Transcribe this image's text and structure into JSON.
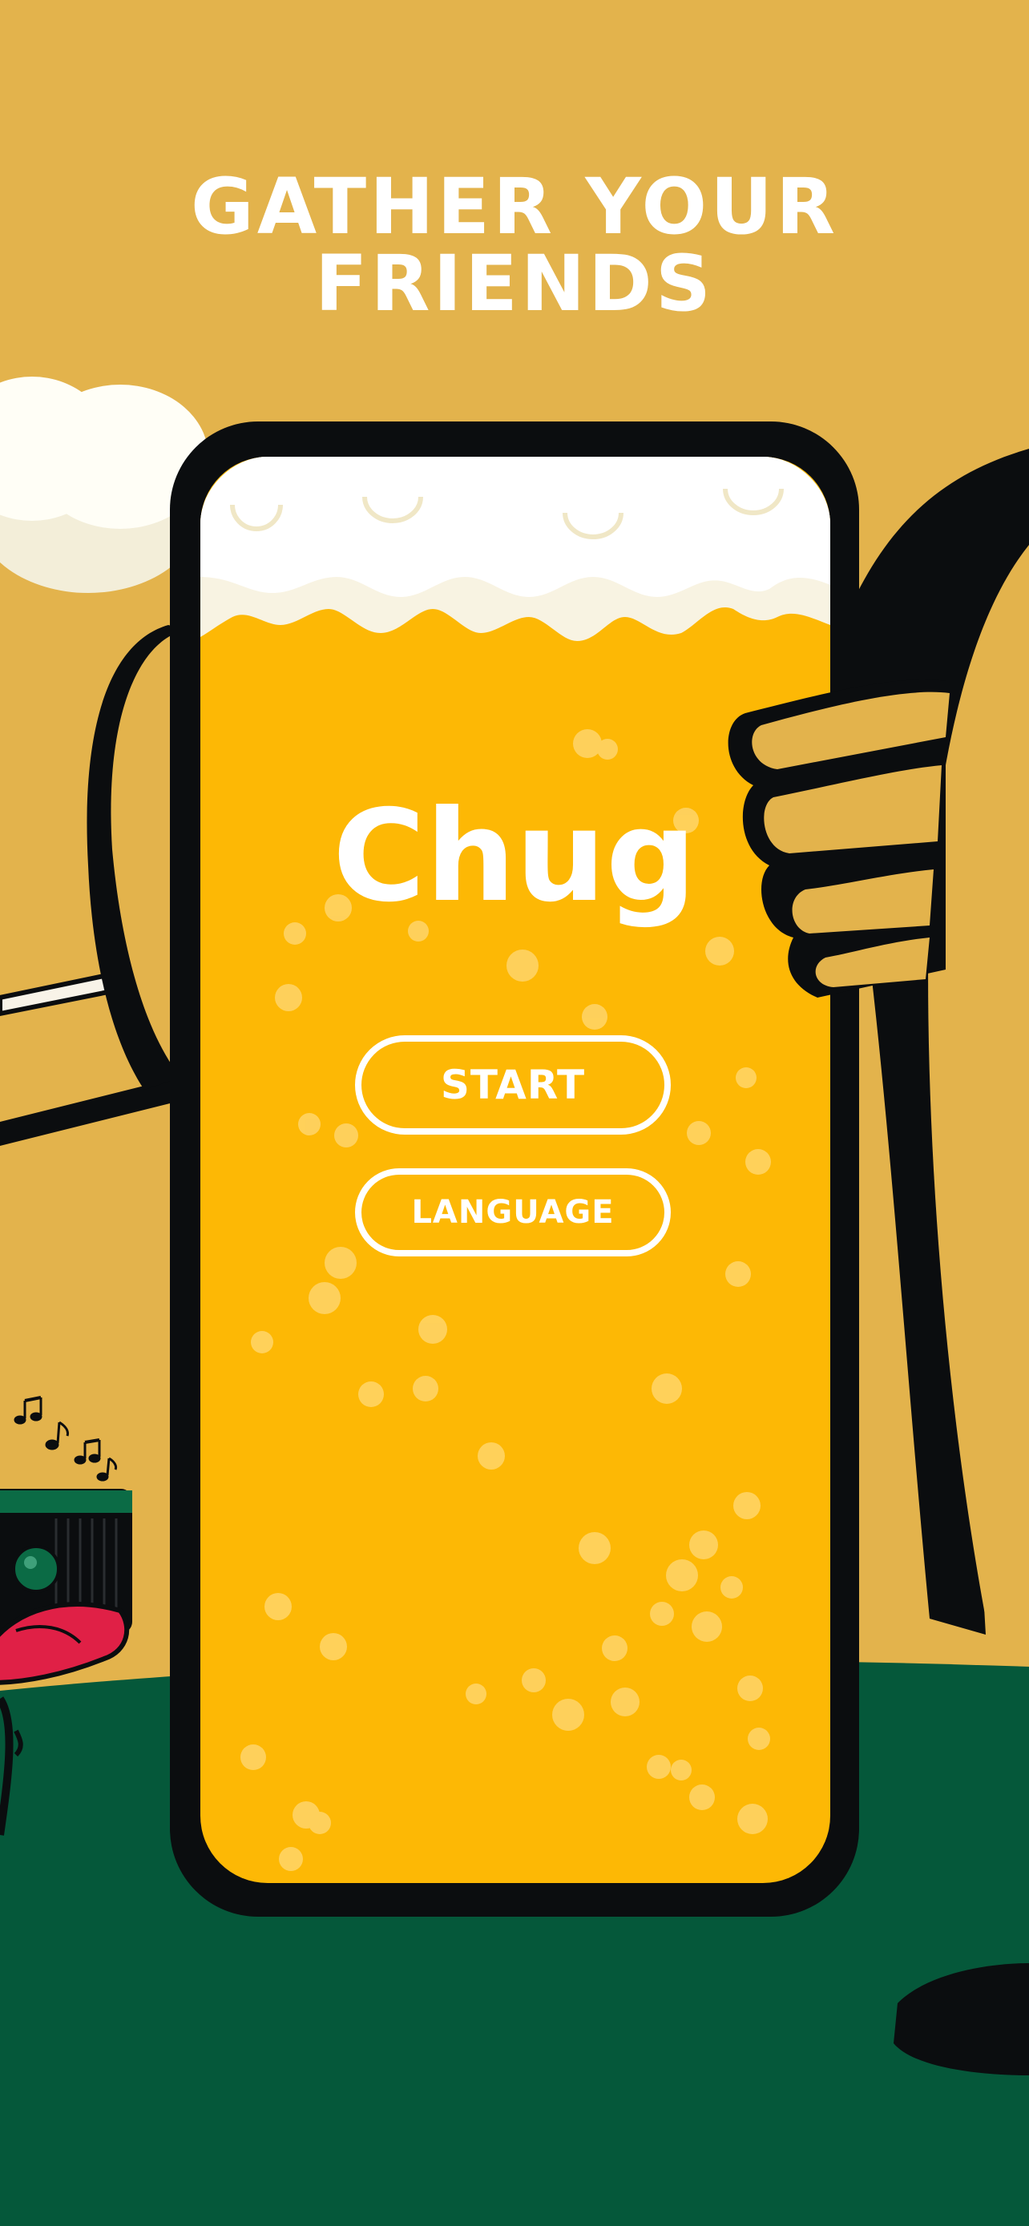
{
  "headline": "GATHER YOUR FRIENDS",
  "app": {
    "title": "Chug"
  },
  "buttons": {
    "start_label": "START",
    "language_label": "LANGUAGE"
  },
  "colors": {
    "background": "#e3b34c",
    "beer": "#fdb805",
    "foam": "#fffbe9",
    "phone_frame": "#0b0d0f",
    "ground": "#05583a",
    "accent_red": "#e02046",
    "text": "#ffffff"
  },
  "icons": [
    "music-notes-icon",
    "speaker-icon"
  ]
}
